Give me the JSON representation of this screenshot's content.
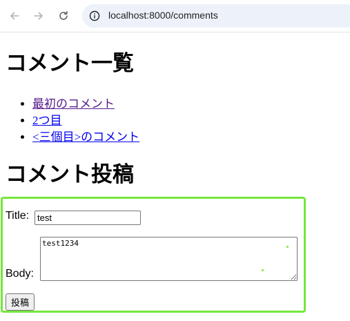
{
  "browser": {
    "url": "localhost:8000/comments",
    "icons": {
      "back": "arrow-left-icon",
      "forward": "arrow-right-icon",
      "reload": "reload-icon",
      "site_info": "info-icon"
    }
  },
  "page": {
    "list_heading": "コメント一覧",
    "comments": [
      {
        "label": "最初のコメント",
        "visited": true
      },
      {
        "label": "2つ目",
        "visited": false
      },
      {
        "label": "<三個目>のコメント",
        "visited": false
      }
    ],
    "post_heading": "コメント投稿",
    "form": {
      "title_label": "Title:",
      "title_value": "test",
      "body_label": "Body:",
      "body_value": "test1234",
      "submit_label": "投稿",
      "highlight_color": "#73e83a"
    }
  }
}
